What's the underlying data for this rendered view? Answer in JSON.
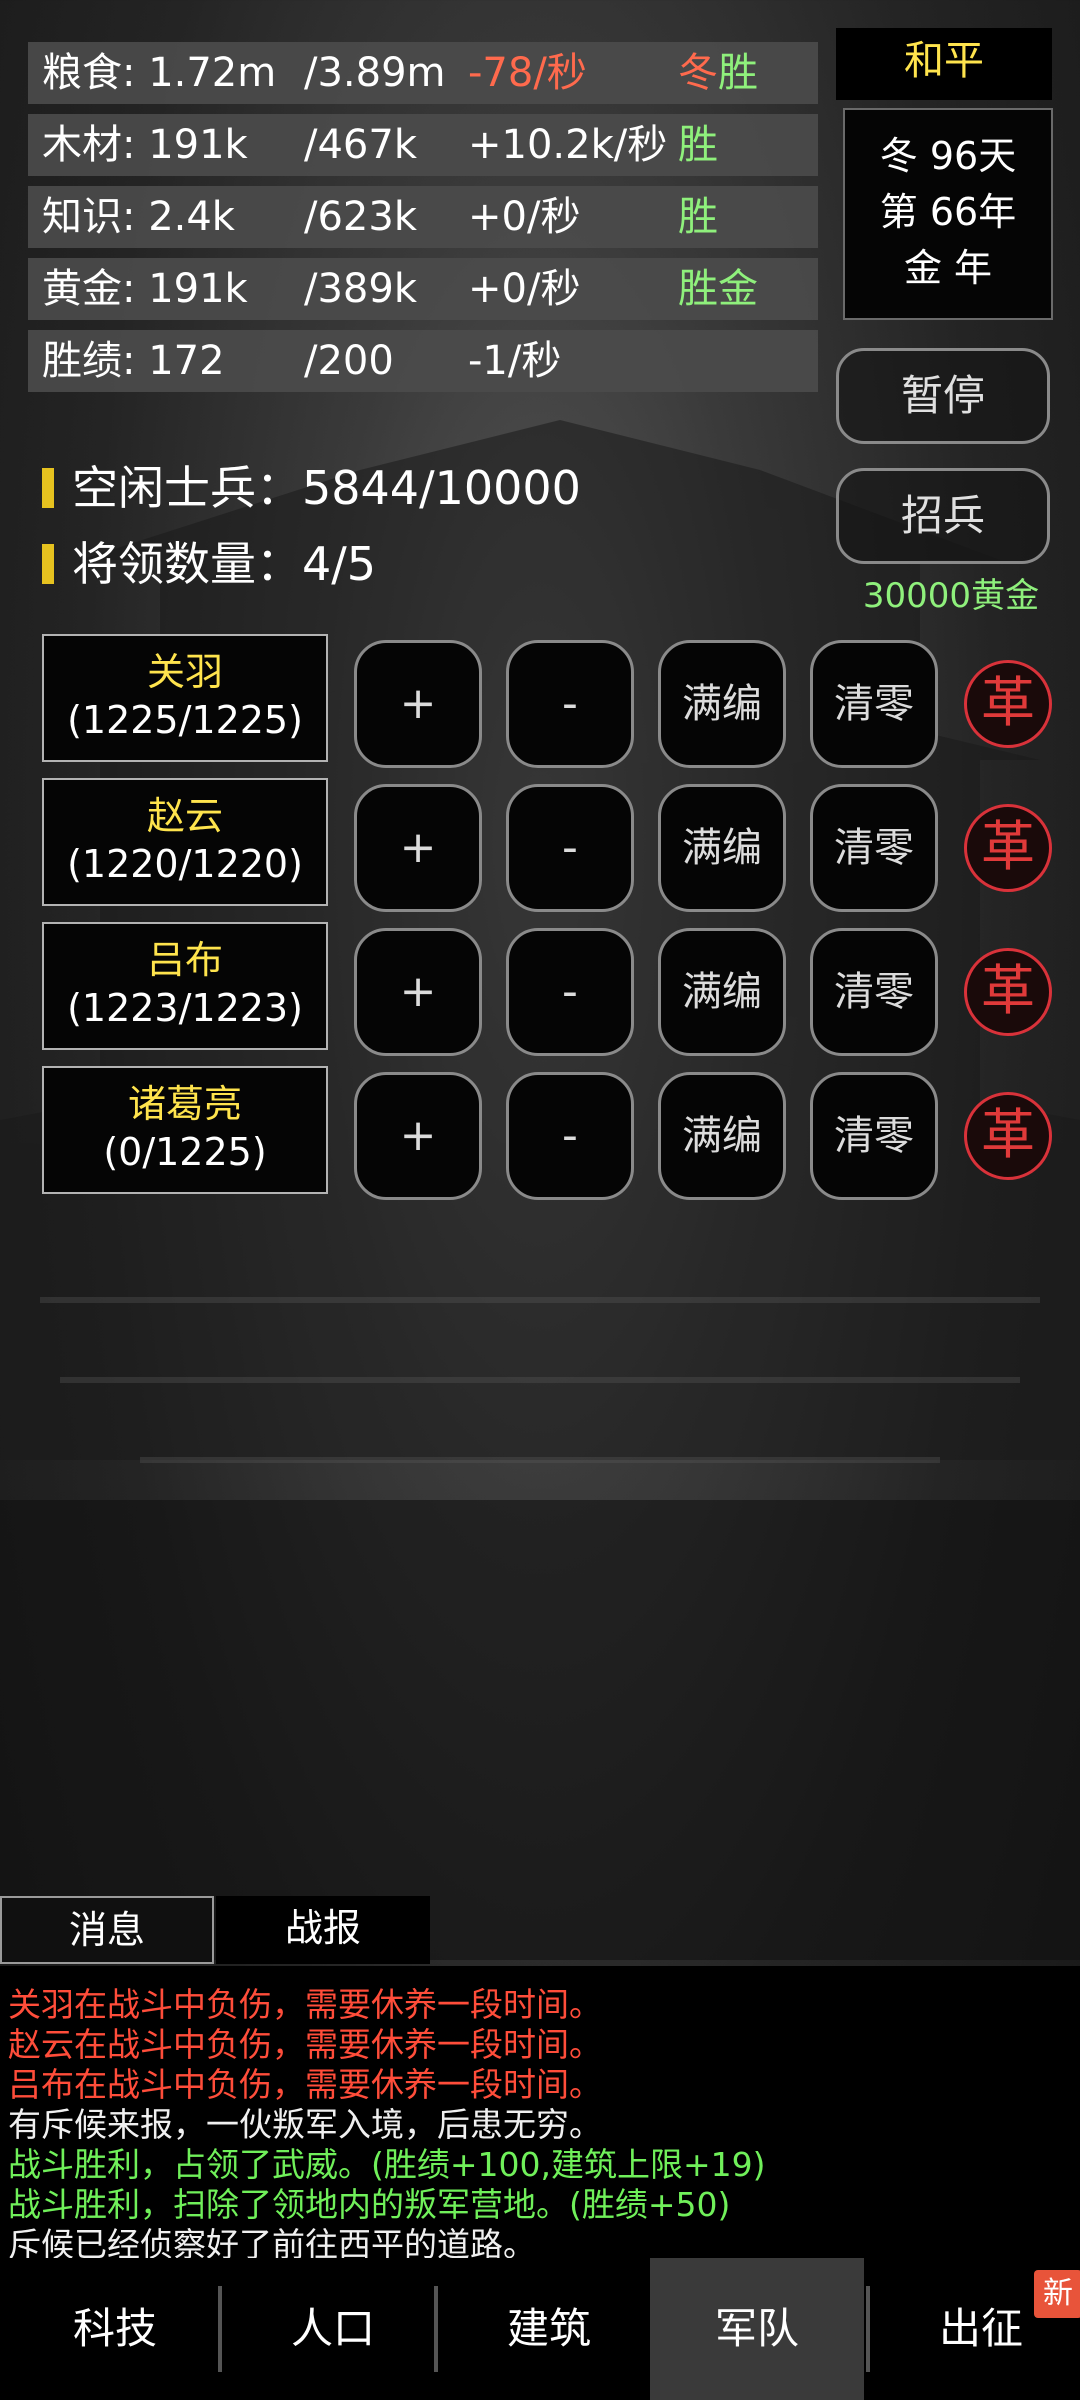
{
  "resources": [
    {
      "name": "粮食: 1.72m",
      "cap": "/3.89m",
      "rate": "-78/秒",
      "flag_a": "冬",
      "flag_b": "胜"
    },
    {
      "name": "木材: 191k",
      "cap": "/467k",
      "rate": "+10.2k/秒",
      "flag_a": "",
      "flag_b": "胜"
    },
    {
      "name": "知识: 2.4k",
      "cap": "/623k",
      "rate": "+0/秒",
      "flag_a": "",
      "flag_b": "胜"
    },
    {
      "name": "黄金: 191k",
      "cap": "/389k",
      "rate": "+0/秒",
      "flag_a": "",
      "flag_b": "胜金"
    },
    {
      "name": "胜绩: 172",
      "cap": "/200",
      "rate": "-1/秒",
      "flag_a": "",
      "flag_b": ""
    }
  ],
  "status": "和平",
  "date": {
    "line1": "冬 96天",
    "line2": "第 66年",
    "line3": "金 年"
  },
  "pause_label": "暂停",
  "recruit_label": "招兵",
  "recruit_cost": "30000黄金",
  "idle_soldiers": "空闲士兵：5844/10000",
  "general_count": "将领数量：4/5",
  "generals": [
    {
      "name": "关羽",
      "count": "(1225/1225)"
    },
    {
      "name": "赵云",
      "count": "(1220/1220)"
    },
    {
      "name": "吕布",
      "count": "(1223/1223)"
    },
    {
      "name": "诸葛亮",
      "count": "(0/1225)"
    }
  ],
  "controls": {
    "plus": "+",
    "minus": "-",
    "fill": "满编",
    "clear": "清零",
    "reform": "革"
  },
  "log_tabs": {
    "messages": "消息",
    "battle": "战报"
  },
  "log": [
    {
      "text": "关羽在战斗中负伤，需要休养一段时间。",
      "tone": "red"
    },
    {
      "text": "赵云在战斗中负伤，需要休养一段时间。",
      "tone": "red"
    },
    {
      "text": "吕布在战斗中负伤，需要休养一段时间。",
      "tone": "red"
    },
    {
      "text": "有斥候来报，一伙叛军入境，后患无穷。",
      "tone": "white"
    },
    {
      "text": "战斗胜利，占领了武威。(胜绩+100,建筑上限+19)",
      "tone": "green"
    },
    {
      "text": "战斗胜利，扫除了领地内的叛军营地。(胜绩+50)",
      "tone": "green"
    },
    {
      "text": "斥候已经侦察好了前往西平的道路。",
      "tone": "white"
    }
  ],
  "nav": [
    {
      "label": "科技"
    },
    {
      "label": "人口"
    },
    {
      "label": "建筑"
    },
    {
      "label": "军队"
    },
    {
      "label": "出征"
    }
  ],
  "nav_badge": "新",
  "colors": {
    "accent_yellow": "#ffe44d",
    "positive_green": "#8ff07c",
    "negative_red": "#ff6a4d",
    "reform_red": "#e03a3a"
  }
}
